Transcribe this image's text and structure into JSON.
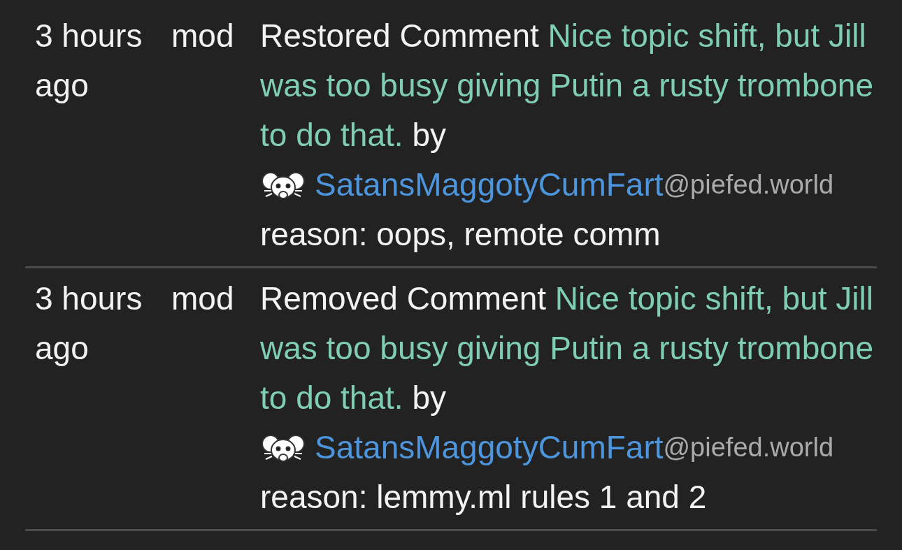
{
  "entries": [
    {
      "time": "3 hours ago",
      "actor": "mod",
      "action": "Restored Comment",
      "comment": "Nice topic shift, but Jill was too busy giving Putin a rusty trombone to do that.",
      "by": "by",
      "user": {
        "name": "SatansMaggotyCumFart",
        "instance": "@piefed.world"
      },
      "reason": "reason: oops, remote comm"
    },
    {
      "time": "3 hours ago",
      "actor": "mod",
      "action": "Removed Comment",
      "comment": "Nice topic shift, but Jill was too busy giving Putin a rusty trombone to do that.",
      "by": "by",
      "user": {
        "name": "SatansMaggotyCumFart",
        "instance": "@piefed.world"
      },
      "reason": "reason: lemmy.ml rules 1 and 2"
    }
  ]
}
